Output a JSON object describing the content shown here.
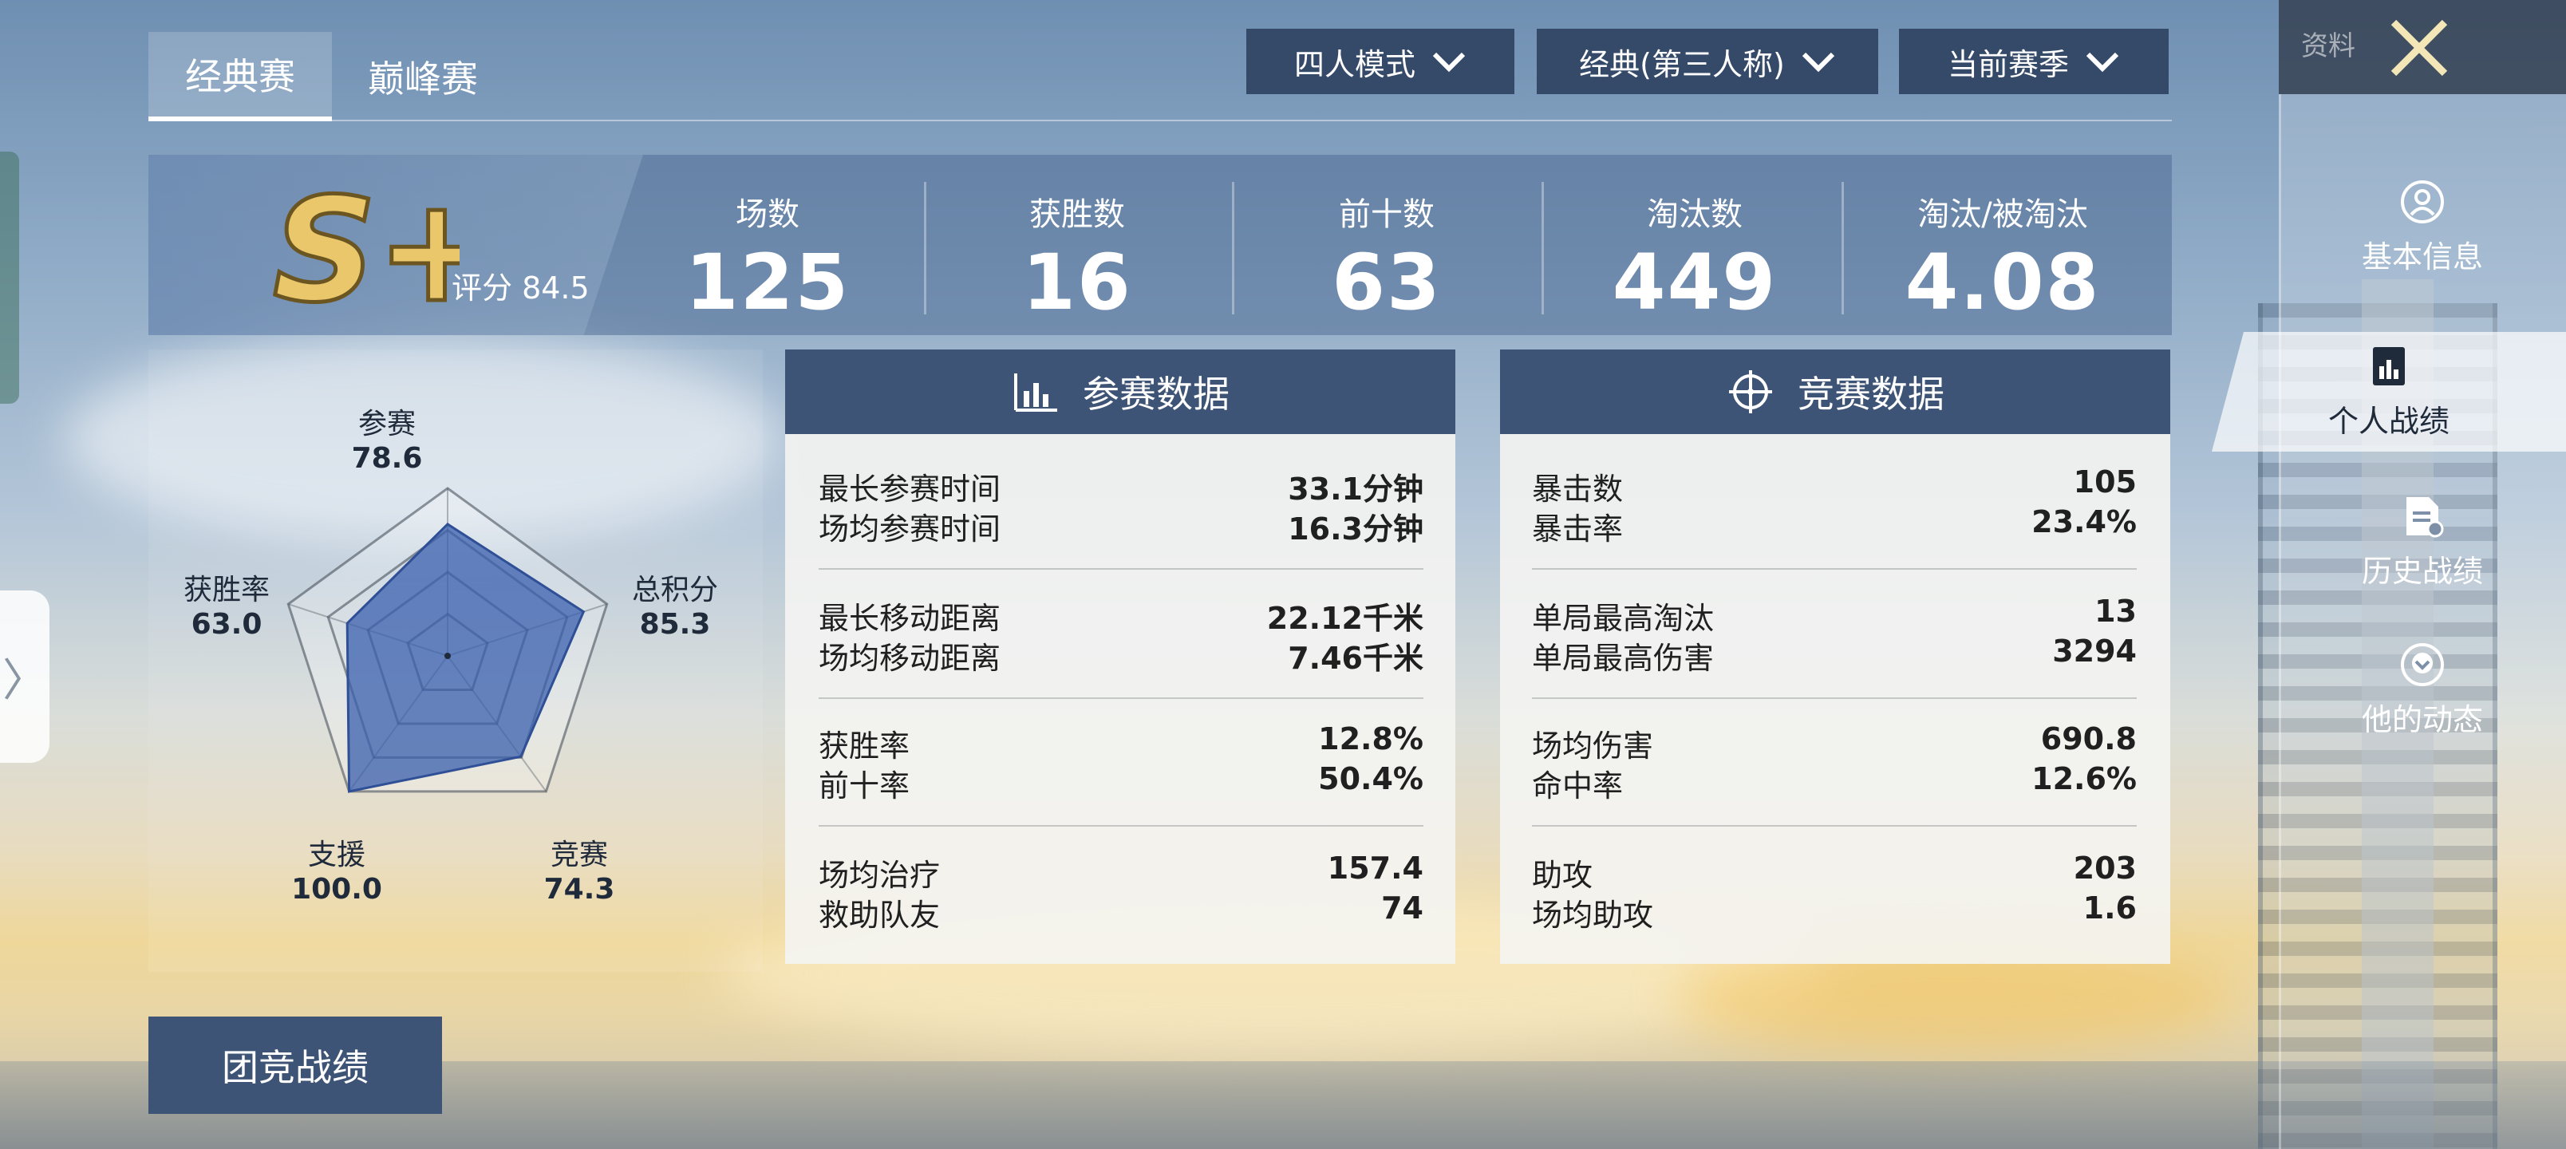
{
  "tabs": {
    "classic": "经典赛",
    "peak": "巅峰赛"
  },
  "filters": {
    "mode": "四人模式",
    "perspective": "经典(第三人称)",
    "season": "当前赛季"
  },
  "side_panel": {
    "header_label": "资料",
    "items": [
      {
        "label": "基本信息",
        "icon": "person-icon"
      },
      {
        "label": "个人战绩",
        "icon": "chart-icon"
      },
      {
        "label": "历史战绩",
        "icon": "document-icon"
      },
      {
        "label": "他的动态",
        "icon": "download-circle-icon"
      }
    ]
  },
  "summary": {
    "rank": "S+",
    "rating_text": "评分 84.5",
    "stats": [
      {
        "label": "场数",
        "value": "125"
      },
      {
        "label": "获胜数",
        "value": "16"
      },
      {
        "label": "前十数",
        "value": "63"
      },
      {
        "label": "淘汰数",
        "value": "449"
      },
      {
        "label": "淘汰/被淘汰",
        "value": "4.08"
      }
    ]
  },
  "radar": {
    "axes": [
      {
        "label": "参赛",
        "value": "78.6",
        "score": 78.6
      },
      {
        "label": "总积分",
        "value": "85.3",
        "score": 85.3
      },
      {
        "label": "竞赛",
        "value": "74.3",
        "score": 74.3
      },
      {
        "label": "支援",
        "value": "100.0",
        "score": 100.0
      },
      {
        "label": "获胜率",
        "value": "63.0",
        "score": 63.0
      }
    ],
    "fill_color": "#3a5fae"
  },
  "participation": {
    "title": "参赛数据",
    "groups": [
      [
        {
          "k": "最长参赛时间",
          "v": "33.1分钟"
        },
        {
          "k": "场均参赛时间",
          "v": "16.3分钟"
        }
      ],
      [
        {
          "k": "最长移动距离",
          "v": "22.12千米"
        },
        {
          "k": "场均移动距离",
          "v": "7.46千米"
        }
      ],
      [
        {
          "k": "获胜率",
          "v": "12.8%"
        },
        {
          "k": "前十率",
          "v": "50.4%"
        }
      ],
      [
        {
          "k": "场均治疗",
          "v": "157.4"
        },
        {
          "k": "救助队友",
          "v": "74"
        }
      ]
    ]
  },
  "competition": {
    "title": "竞赛数据",
    "groups": [
      [
        {
          "k": "暴击数",
          "v": "105"
        },
        {
          "k": "暴击率",
          "v": "23.4%"
        }
      ],
      [
        {
          "k": "单局最高淘汰",
          "v": "13"
        },
        {
          "k": "单局最高伤害",
          "v": "3294"
        }
      ],
      [
        {
          "k": "场均伤害",
          "v": "690.8"
        },
        {
          "k": "命中率",
          "v": "12.6%"
        }
      ],
      [
        {
          "k": "助攻",
          "v": "203"
        },
        {
          "k": "场均助攻",
          "v": "1.6"
        }
      ]
    ]
  },
  "team_button": "团竞战绩",
  "colors": {
    "header_navy": "#3e5476",
    "dropdown_navy": "#354a69",
    "rank_gold": "#e9c76a"
  }
}
